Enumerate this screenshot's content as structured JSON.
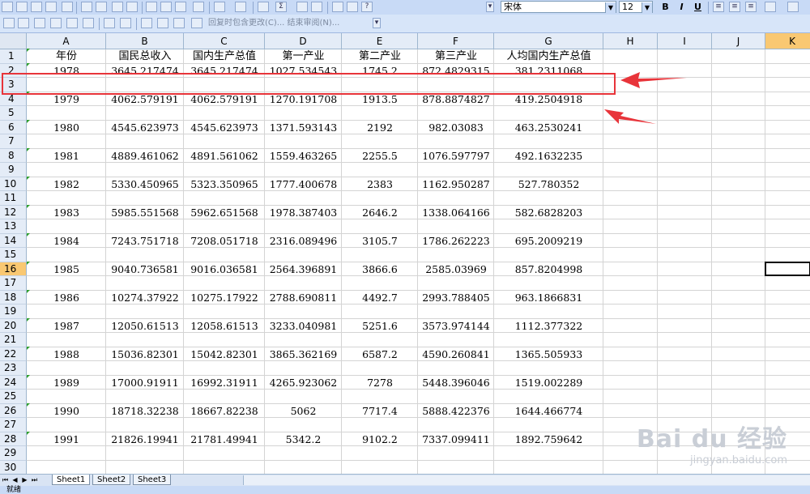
{
  "toolbar": {
    "font_name": "宋体",
    "font_size": "12",
    "review_text": "回复时包含更改(C)... 结束审阅(N)..."
  },
  "columns": [
    "A",
    "B",
    "C",
    "D",
    "E",
    "F",
    "G",
    "H",
    "I",
    "J",
    "K"
  ],
  "row_numbers": [
    "1",
    "2",
    "3",
    "4",
    "5",
    "6",
    "7",
    "8",
    "9",
    "10",
    "11",
    "12",
    "13",
    "14",
    "15",
    "16",
    "17",
    "18",
    "19",
    "20",
    "21",
    "22",
    "23",
    "24",
    "25",
    "26",
    "27",
    "28",
    "29",
    "30"
  ],
  "active_cell": {
    "column": "K",
    "row": "16"
  },
  "headers": [
    "年份",
    "国民总收入",
    "国内生产总值",
    "第一产业",
    "第二产业",
    "第三产业",
    "人均国内生产总值"
  ],
  "data_rows": [
    {
      "row": "2",
      "cells": [
        "1978",
        "3645.217474",
        "3645.217474",
        "1027.534543",
        "1745.2",
        "872.4829315",
        "381.2311068"
      ]
    },
    {
      "row": "4",
      "cells": [
        "1979",
        "4062.579191",
        "4062.579191",
        "1270.191708",
        "1913.5",
        "878.8874827",
        "419.2504918"
      ]
    },
    {
      "row": "6",
      "cells": [
        "1980",
        "4545.623973",
        "4545.623973",
        "1371.593143",
        "2192",
        "982.03083",
        "463.2530241"
      ]
    },
    {
      "row": "8",
      "cells": [
        "1981",
        "4889.461062",
        "4891.561062",
        "1559.463265",
        "2255.5",
        "1076.597797",
        "492.1632235"
      ]
    },
    {
      "row": "10",
      "cells": [
        "1982",
        "5330.450965",
        "5323.350965",
        "1777.400678",
        "2383",
        "1162.950287",
        "527.780352"
      ]
    },
    {
      "row": "12",
      "cells": [
        "1983",
        "5985.551568",
        "5962.651568",
        "1978.387403",
        "2646.2",
        "1338.064166",
        "582.6828203"
      ]
    },
    {
      "row": "14",
      "cells": [
        "1984",
        "7243.751718",
        "7208.051718",
        "2316.089496",
        "3105.7",
        "1786.262223",
        "695.2009219"
      ]
    },
    {
      "row": "16",
      "cells": [
        "1985",
        "9040.736581",
        "9016.036581",
        "2564.396891",
        "3866.6",
        "2585.03969",
        "857.8204998"
      ]
    },
    {
      "row": "18",
      "cells": [
        "1986",
        "10274.37922",
        "10275.17922",
        "2788.690811",
        "4492.7",
        "2993.788405",
        "963.1866831"
      ]
    },
    {
      "row": "20",
      "cells": [
        "1987",
        "12050.61513",
        "12058.61513",
        "3233.040981",
        "5251.6",
        "3573.974144",
        "1112.377322"
      ]
    },
    {
      "row": "22",
      "cells": [
        "1988",
        "15036.82301",
        "15042.82301",
        "3865.362169",
        "6587.2",
        "4590.260841",
        "1365.505933"
      ]
    },
    {
      "row": "24",
      "cells": [
        "1989",
        "17000.91911",
        "16992.31911",
        "4265.923062",
        "7278",
        "5448.396046",
        "1519.002289"
      ]
    },
    {
      "row": "26",
      "cells": [
        "1990",
        "18718.32238",
        "18667.82238",
        "5062",
        "7717.4",
        "5888.422376",
        "1644.466774"
      ]
    },
    {
      "row": "28",
      "cells": [
        "1991",
        "21826.19941",
        "21781.49941",
        "5342.2",
        "9102.2",
        "7337.099411",
        "1892.759642"
      ]
    }
  ],
  "sheets": [
    "Sheet1",
    "Sheet2",
    "Sheet3"
  ],
  "active_sheet": "Sheet1",
  "status": "就绪",
  "watermark": {
    "brand": "Bai du 经验",
    "url": "jingyan.baidu.com"
  },
  "colors": {
    "highlight_red": "#e8343a",
    "active_header": "#f9c872"
  }
}
